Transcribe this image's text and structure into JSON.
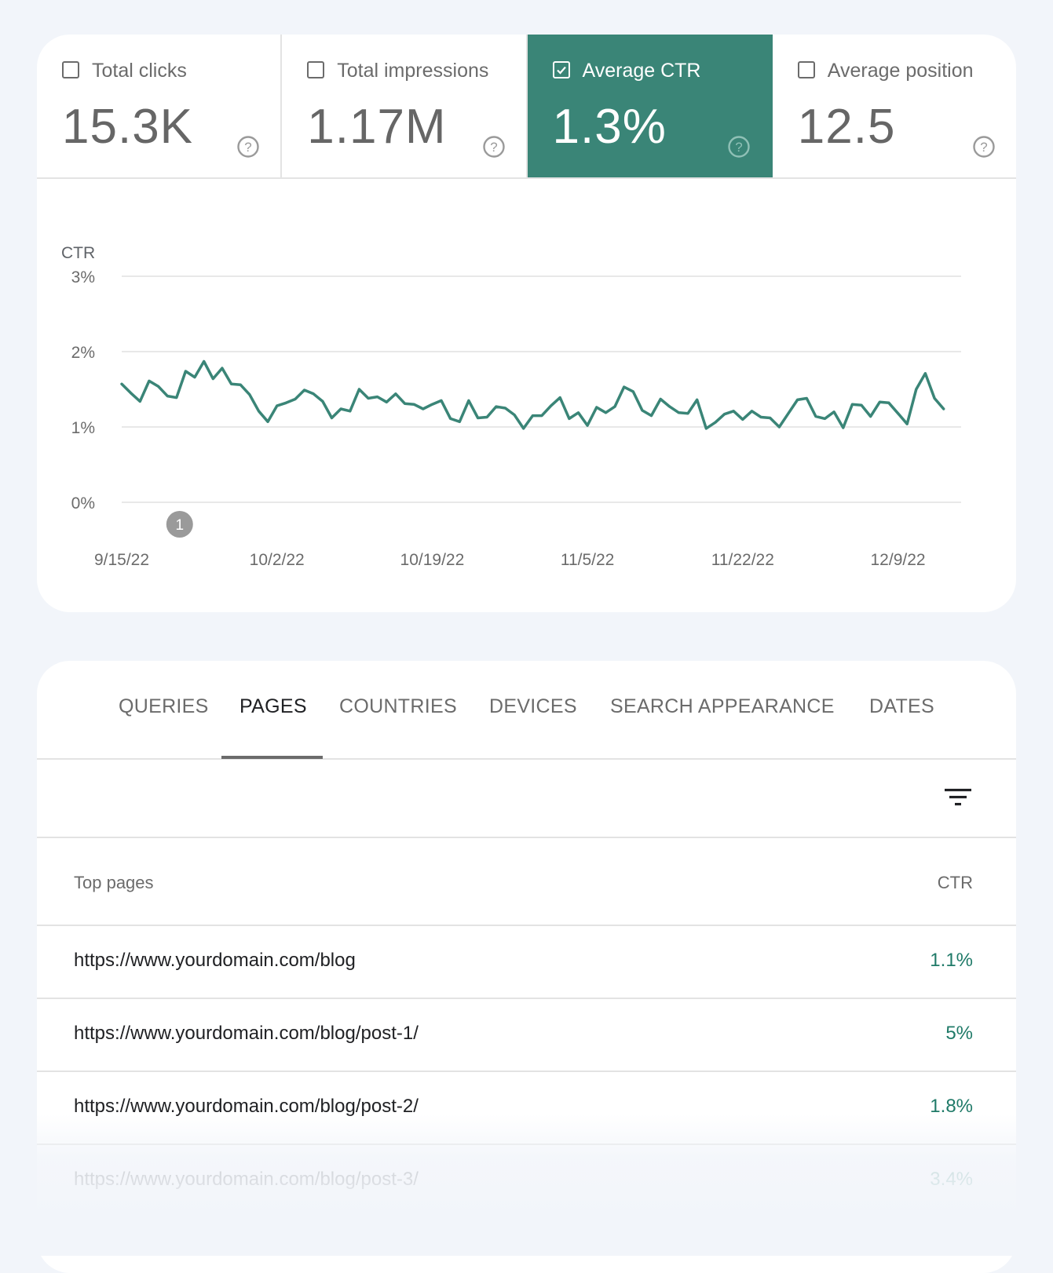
{
  "colors": {
    "accent": "#3a8577",
    "ctr_value": "#1f7a68",
    "page_bg": "#f2f5fa"
  },
  "metrics": [
    {
      "label": "Total clicks",
      "value": "15.3K",
      "checked": false,
      "icon": "help-circle-icon"
    },
    {
      "label": "Total impressions",
      "value": "1.17M",
      "checked": false,
      "icon": "help-circle-icon"
    },
    {
      "label": "Average CTR",
      "value": "1.3%",
      "checked": true,
      "icon": "help-circle-icon"
    },
    {
      "label": "Average position",
      "value": "12.5",
      "checked": false,
      "icon": "help-circle-icon"
    }
  ],
  "chart_data": {
    "type": "line",
    "title": "",
    "ylabel": "CTR",
    "xlabel": "",
    "ylim": [
      0,
      3
    ],
    "yticks": [
      {
        "value": 3,
        "label": "3%"
      },
      {
        "value": 2,
        "label": "2%"
      },
      {
        "value": 1,
        "label": "1%"
      },
      {
        "value": 0,
        "label": "0%"
      }
    ],
    "x_start": "9/15/22",
    "x_days": 90,
    "xticks": [
      {
        "day": 0,
        "label": "9/15/22"
      },
      {
        "day": 17,
        "label": "10/2/22"
      },
      {
        "day": 34,
        "label": "10/19/22"
      },
      {
        "day": 51,
        "label": "11/5/22"
      },
      {
        "day": 68,
        "label": "11/22/22"
      },
      {
        "day": 85,
        "label": "12/9/22"
      }
    ],
    "grid": true,
    "annotations": [
      {
        "day": 6,
        "label": "1"
      }
    ],
    "series": [
      {
        "name": "CTR",
        "values": [
          1.57,
          1.45,
          1.34,
          1.61,
          1.54,
          1.41,
          1.39,
          1.74,
          1.66,
          1.87,
          1.64,
          1.78,
          1.57,
          1.56,
          1.43,
          1.21,
          1.07,
          1.28,
          1.32,
          1.37,
          1.49,
          1.44,
          1.34,
          1.12,
          1.24,
          1.21,
          1.5,
          1.38,
          1.4,
          1.33,
          1.44,
          1.31,
          1.3,
          1.24,
          1.3,
          1.35,
          1.11,
          1.07,
          1.35,
          1.12,
          1.13,
          1.27,
          1.25,
          1.16,
          0.98,
          1.15,
          1.15,
          1.28,
          1.39,
          1.11,
          1.19,
          1.02,
          1.26,
          1.19,
          1.27,
          1.53,
          1.47,
          1.22,
          1.15,
          1.37,
          1.27,
          1.19,
          1.18,
          1.36,
          0.98,
          1.06,
          1.17,
          1.21,
          1.1,
          1.21,
          1.13,
          1.12,
          1.0,
          1.18,
          1.36,
          1.38,
          1.14,
          1.11,
          1.2,
          0.99,
          1.3,
          1.29,
          1.14,
          1.33,
          1.32,
          1.18,
          1.04,
          1.5,
          1.71,
          1.38,
          1.24
        ]
      }
    ]
  },
  "tabs": [
    {
      "label": "QUERIES",
      "active": false
    },
    {
      "label": "PAGES",
      "active": true
    },
    {
      "label": "COUNTRIES",
      "active": false
    },
    {
      "label": "DEVICES",
      "active": false
    },
    {
      "label": "SEARCH APPEARANCE",
      "active": false
    },
    {
      "label": "DATES",
      "active": false
    }
  ],
  "toolbar": {
    "filter_icon": "filter-list-icon"
  },
  "table": {
    "columns": [
      "Top pages",
      "CTR"
    ],
    "rows": [
      {
        "url": "https://www.yourdomain.com/blog",
        "ctr": "1.1%"
      },
      {
        "url": "https://www.yourdomain.com/blog/post-1/",
        "ctr": "5%"
      },
      {
        "url": "https://www.yourdomain.com/blog/post-2/",
        "ctr": "1.8%"
      },
      {
        "url": "https://www.yourdomain.com/blog/post-3/",
        "ctr": "3.4%"
      }
    ]
  }
}
